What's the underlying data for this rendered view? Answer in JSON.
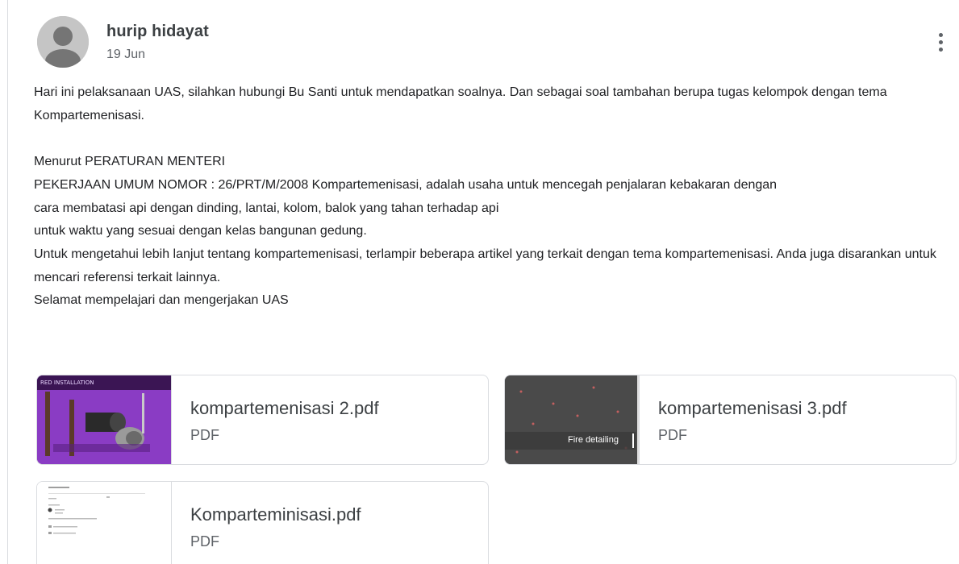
{
  "post": {
    "author": "hurip hidayat",
    "date": "19 Jun",
    "more_icon": "more-vertical-icon",
    "paragraphs": [
      "Hari ini pelaksanaan UAS, silahkan hubungi Bu Santi untuk mendapatkan soalnya. Dan sebagai soal tambahan berupa tugas kelompok dengan tema Kompartemenisasi.",
      "Menurut PERATURAN MENTERI\nPEKERJAAN UMUM  NOMOR : 26/PRT/M/2008 Kompartemenisasi, adalah usaha untuk mencegah penjalaran kebakaran dengan\ncara membatasi api dengan dinding, lantai, kolom, balok yang tahan terhadap api\nuntuk waktu yang sesuai dengan kelas bangunan gedung.\nUntuk mengetahui lebih lanjut tentang kompartemenisasi, terlampir beberapa artikel yang terkait dengan tema kompartemenisasi. Anda juga disarankan untuk mencari referensi terkait lainnya.\nSelamat mempelajari dan mengerjakan UAS"
    ]
  },
  "attachments": [
    {
      "name": "kompartemenisasi 2.pdf",
      "type": "PDF",
      "thumb_caption": "RED INSTALLATION"
    },
    {
      "name": "kompartemenisasi 3.pdf",
      "type": "PDF",
      "thumb_caption": "Fire detailing"
    },
    {
      "name": "Komparteminisasi.pdf",
      "type": "PDF"
    }
  ],
  "colors": {
    "text": "#202124",
    "secondary": "#5f6368",
    "border": "#dadce0"
  }
}
